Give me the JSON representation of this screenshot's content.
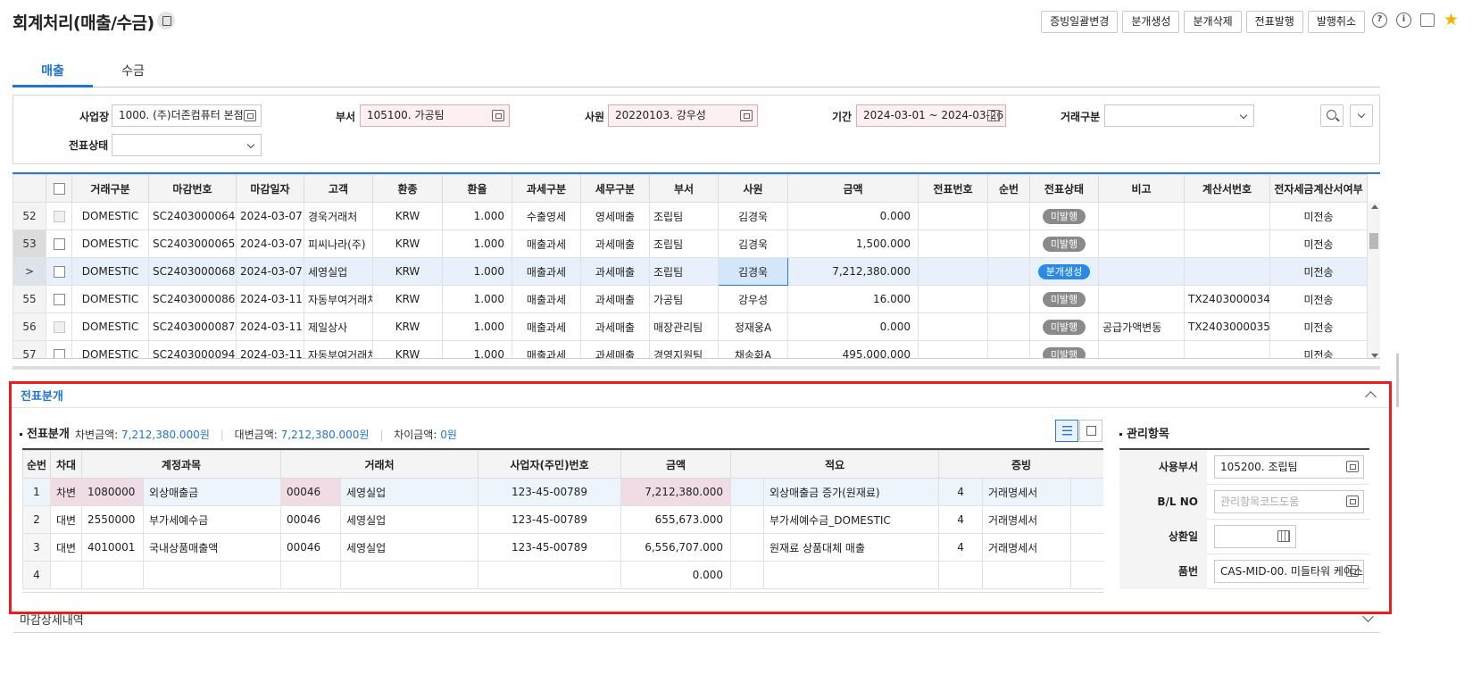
{
  "header": {
    "title": "회계처리(매출/수금)",
    "buttons": [
      "증빙일괄변경",
      "분개생성",
      "분개삭제",
      "전표발행",
      "발행취소"
    ]
  },
  "tabs": [
    "매출",
    "수금"
  ],
  "search": {
    "workplace_label": "사업장",
    "workplace_value": "1000. (주)더존컴퓨터 본점",
    "dept_label": "부서",
    "dept_value": "105100. 가공팀",
    "employee_label": "사원",
    "employee_value": "20220103. 강우성",
    "period_label": "기간",
    "period_value": "2024-03-01 ~ 2024-03-26",
    "trade_type_label": "거래구분",
    "trade_type_value": "",
    "voucher_state_label": "전표상태",
    "voucher_state_value": ""
  },
  "grid": {
    "columns": [
      "",
      "",
      "거래구분",
      "마감번호",
      "마감일자",
      "고객",
      "환종",
      "환율",
      "과세구분",
      "세무구분",
      "부서",
      "사원",
      "금액",
      "전표번호",
      "순번",
      "전표상태",
      "비고",
      "계산서번호",
      "전자세금계산서여부"
    ],
    "rows": [
      {
        "no": "52",
        "trade": "DOMESTIC",
        "close_no": "SC2403000064",
        "date": "2024-03-07",
        "customer": "경욱거래처",
        "cur": "KRW",
        "rate": "1.000",
        "tax": "수출영세",
        "taxk": "영세매출",
        "dept": "조립팀",
        "emp": "김경욱",
        "amount": "0.000",
        "vno": "",
        "seq": "",
        "state": "미발행",
        "memo": "",
        "inv": "",
        "etax": "미전송"
      },
      {
        "no": "53",
        "trade": "DOMESTIC",
        "close_no": "SC2403000065",
        "date": "2024-03-07",
        "customer": "피씨나라(주)",
        "cur": "KRW",
        "rate": "1.000",
        "tax": "매출과세",
        "taxk": "과세매출",
        "dept": "조립팀",
        "emp": "김경욱",
        "amount": "1,500.000",
        "vno": "",
        "seq": "",
        "state": "미발행",
        "memo": "",
        "inv": "",
        "etax": "미전송"
      },
      {
        "no": ">",
        "trade": "DOMESTIC",
        "close_no": "SC2403000068",
        "date": "2024-03-07",
        "customer": "세영실업",
        "cur": "KRW",
        "rate": "1.000",
        "tax": "매출과세",
        "taxk": "과세매출",
        "dept": "조립팀",
        "emp": "김경욱",
        "amount": "7,212,380.000",
        "vno": "",
        "seq": "",
        "state": "분개생성",
        "memo": "",
        "inv": "",
        "etax": "미전송"
      },
      {
        "no": "55",
        "trade": "DOMESTIC",
        "close_no": "SC2403000086",
        "date": "2024-03-11",
        "customer": "자동부여거래처",
        "cur": "KRW",
        "rate": "1.000",
        "tax": "매출과세",
        "taxk": "과세매출",
        "dept": "가공팀",
        "emp": "강우성",
        "amount": "16.000",
        "vno": "",
        "seq": "",
        "state": "미발행",
        "memo": "",
        "inv": "TX2403000034",
        "etax": "미전송"
      },
      {
        "no": "56",
        "trade": "DOMESTIC",
        "close_no": "SC2403000087",
        "date": "2024-03-11",
        "customer": "제일상사",
        "cur": "KRW",
        "rate": "1.000",
        "tax": "매출과세",
        "taxk": "과세매출",
        "dept": "매장관리팀",
        "emp": "정재웅A",
        "amount": "0.000",
        "vno": "",
        "seq": "",
        "state": "미발행",
        "memo": "공급가액변동",
        "inv": "TX2403000035",
        "etax": "미전송"
      },
      {
        "no": "57",
        "trade": "DOMESTIC",
        "close_no": "SC2403000094",
        "date": "2024-03-11",
        "customer": "자동부여거래처",
        "cur": "KRW",
        "rate": "1.000",
        "tax": "매출과세",
        "taxk": "과세매출",
        "dept": "경영지원팀",
        "emp": "채송화A",
        "amount": "495,000.000",
        "vno": "",
        "seq": "",
        "state": "미발행",
        "memo": "",
        "inv": "",
        "etax": "미전송"
      }
    ]
  },
  "journal_panel": {
    "header": "전표분개",
    "section_title": "전표분개",
    "debit_label": "차변금액:",
    "debit_value": "7,212,380.000원",
    "credit_label": "대변금액:",
    "credit_value": "7,212,380.000원",
    "diff_label": "차이금액:",
    "diff_value": "0원",
    "columns": [
      "순번",
      "차대",
      "계정과목",
      "거래처",
      "사업자(주민)번호",
      "금액",
      "적요",
      "증빙"
    ],
    "rows": [
      {
        "no": "1",
        "dc": "차변",
        "acct_code": "1080000",
        "acct_name": "외상매출금",
        "cust_code": "00046",
        "cust_name": "세영실업",
        "biz_no": "123-45-00789",
        "amount": "7,212,380.000",
        "summary": "외상매출금 증가(원재료)",
        "ev_code": "4",
        "ev_name": "거래명세서"
      },
      {
        "no": "2",
        "dc": "대변",
        "acct_code": "2550000",
        "acct_name": "부가세예수금",
        "cust_code": "00046",
        "cust_name": "세영실업",
        "biz_no": "123-45-00789",
        "amount": "655,673.000",
        "summary": "부가세예수금_DOMESTIC",
        "ev_code": "4",
        "ev_name": "거래명세서"
      },
      {
        "no": "3",
        "dc": "대변",
        "acct_code": "4010001",
        "acct_name": "국내상품매출액",
        "cust_code": "00046",
        "cust_name": "세영실업",
        "biz_no": "123-45-00789",
        "amount": "6,556,707.000",
        "summary": "원재료 상품대체 매출",
        "ev_code": "4",
        "ev_name": "거래명세서"
      },
      {
        "no": "4",
        "dc": "",
        "acct_code": "",
        "acct_name": "",
        "cust_code": "",
        "cust_name": "",
        "biz_no": "",
        "amount": "0.000",
        "summary": "",
        "ev_code": "",
        "ev_name": ""
      }
    ]
  },
  "management": {
    "title": "관리항목",
    "use_dept_label": "사용부서",
    "use_dept_value": "105200. 조립팀",
    "bl_label": "B/L NO",
    "bl_placeholder": "관리항목코드도움",
    "repay_label": "상환일",
    "repay_value": "",
    "item_label": "품번",
    "item_value": "CAS-MID-00. 미들타워 케이스"
  },
  "bottom_section": "마감상세내역"
}
